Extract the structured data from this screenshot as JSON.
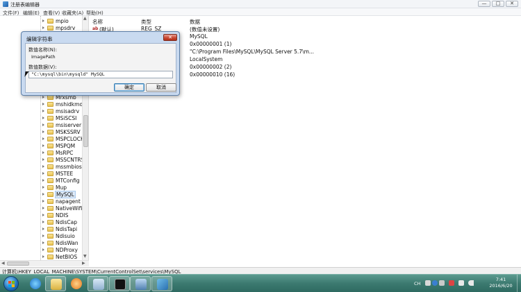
{
  "window": {
    "title": "注册表编辑器",
    "buttons": {
      "minimize": "—",
      "maximize": "□",
      "close": "✕"
    }
  },
  "menu": [
    "文件(F)",
    "编辑(E)",
    "查看(V)",
    "收藏夹(A)",
    "帮助(H)"
  ],
  "tree": {
    "items_top": [
      "mpio",
      "mpsdrv"
    ],
    "items": [
      "Mrxsmb",
      "mshidkmdf",
      "msisadrv",
      "MSiSCSI",
      "msiserver",
      "MSKSSRV",
      "MSPCLOCK",
      "MSPQM",
      "MsRPC",
      "MSSCNTRS",
      "mssmbios",
      "MSTEE",
      "MTConfig",
      "Mup",
      "MySQL",
      "napagent",
      "NativeWifiP",
      "NDIS",
      "NdisCap",
      "NdisTapi",
      "Ndisuio",
      "NdisWan",
      "NDProxy",
      "NetBIOS"
    ],
    "selected": "MySQL"
  },
  "list": {
    "headers": {
      "name": "名称",
      "type": "类型",
      "data": "数据"
    },
    "default_row": {
      "name": "(默认)",
      "type": "REG_SZ",
      "data": "(数值未设置)"
    },
    "data_values": [
      "MySQL",
      "0x00000001 (1)",
      "\"C:\\Program Files\\MySQL\\MySQL Server 5.7\\m...",
      "LocalSystem",
      "0x00000002 (2)",
      "0x00000010 (16)"
    ]
  },
  "dialog": {
    "title": "编辑字符串",
    "close": "✕",
    "name_label": "数值名称(N):",
    "name_value": "ImagePath",
    "data_label": "数值数据(V):",
    "data_value": "\"C:\\mysql\\bin\\mysqld\" MySQL",
    "ok": "确定",
    "cancel": "取消"
  },
  "status": "计算机\\HKEY_LOCAL_MACHINE\\SYSTEM\\CurrentControlSet\\services\\MySQL",
  "taskbar": {
    "tray_lang": "CH",
    "time": "7:41",
    "date": "2016/6/20"
  }
}
